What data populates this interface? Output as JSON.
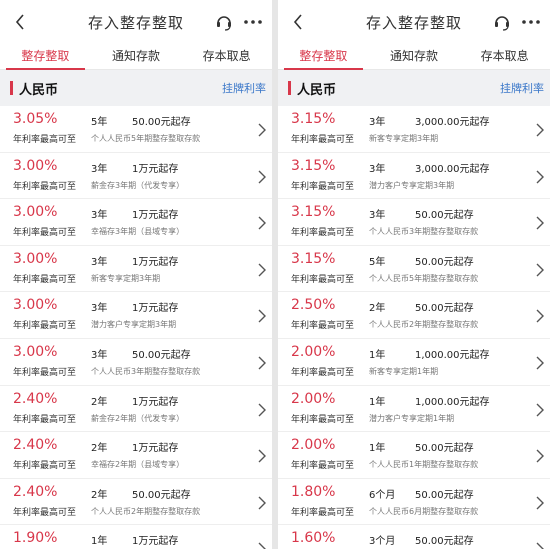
{
  "nav": {
    "title": "存入整存整取"
  },
  "tabs": [
    "整存整取",
    "通知存款",
    "存本取息"
  ],
  "section": {
    "currency": "人民币",
    "link": "挂牌利率"
  },
  "rate_label": "年利率最高可至",
  "colors": {
    "accent": "#d8374a",
    "link": "#3b78c9"
  },
  "icons": [
    "back-arrow-icon",
    "customer-service-icon",
    "more-icon",
    "chevron-right-icon"
  ],
  "left": {
    "items": [
      {
        "rate": "3.05%",
        "term": "5年",
        "min": "50.00元起存",
        "desc": "个人人民币5年期整存整取存款"
      },
      {
        "rate": "3.00%",
        "term": "3年",
        "min": "1万元起存",
        "desc": "薪金存3年期（代发专享）"
      },
      {
        "rate": "3.00%",
        "term": "3年",
        "min": "1万元起存",
        "desc": "幸福存3年期（县域专享）"
      },
      {
        "rate": "3.00%",
        "term": "3年",
        "min": "1万元起存",
        "desc": "新客专享定期3年期"
      },
      {
        "rate": "3.00%",
        "term": "3年",
        "min": "1万元起存",
        "desc": "潜力客户专享定期3年期"
      },
      {
        "rate": "3.00%",
        "term": "3年",
        "min": "50.00元起存",
        "desc": "个人人民币3年期整存整取存款"
      },
      {
        "rate": "2.40%",
        "term": "2年",
        "min": "1万元起存",
        "desc": "薪金存2年期（代发专享）"
      },
      {
        "rate": "2.40%",
        "term": "2年",
        "min": "1万元起存",
        "desc": "幸福存2年期（县域专享）"
      },
      {
        "rate": "2.40%",
        "term": "2年",
        "min": "50.00元起存",
        "desc": "个人人民币2年期整存整取存款"
      },
      {
        "rate": "1.90%",
        "term": "1年",
        "min": "1万元起存",
        "desc": ""
      }
    ]
  },
  "right": {
    "items": [
      {
        "rate": "3.15%",
        "term": "3年",
        "min": "3,000.00元起存",
        "desc": "新客专享定期3年期"
      },
      {
        "rate": "3.15%",
        "term": "3年",
        "min": "3,000.00元起存",
        "desc": "潜力客户专享定期3年期"
      },
      {
        "rate": "3.15%",
        "term": "3年",
        "min": "50.00元起存",
        "desc": "个人人民币3年期整存整取存款"
      },
      {
        "rate": "3.15%",
        "term": "5年",
        "min": "50.00元起存",
        "desc": "个人人民币5年期整存整取存款"
      },
      {
        "rate": "2.50%",
        "term": "2年",
        "min": "50.00元起存",
        "desc": "个人人民币2年期整存整取存款"
      },
      {
        "rate": "2.00%",
        "term": "1年",
        "min": "1,000.00元起存",
        "desc": "新客专享定期1年期"
      },
      {
        "rate": "2.00%",
        "term": "1年",
        "min": "1,000.00元起存",
        "desc": "潜力客户专享定期1年期"
      },
      {
        "rate": "2.00%",
        "term": "1年",
        "min": "50.00元起存",
        "desc": "个人人民币1年期整存整取存款"
      },
      {
        "rate": "1.80%",
        "term": "6个月",
        "min": "50.00元起存",
        "desc": "个人人民币6月期整存整取存款"
      },
      {
        "rate": "1.60%",
        "term": "3个月",
        "min": "50.00元起存",
        "desc": ""
      }
    ]
  }
}
